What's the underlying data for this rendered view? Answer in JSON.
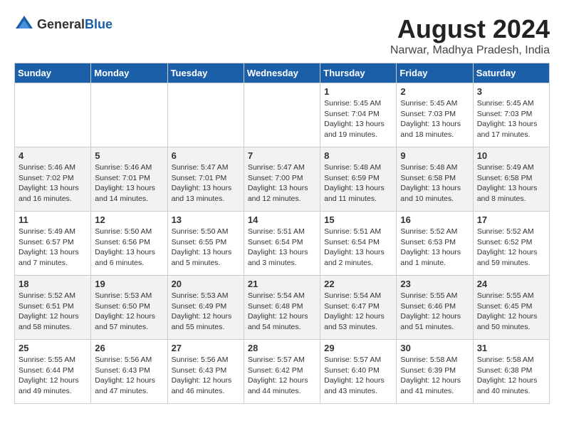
{
  "header": {
    "logo_general": "General",
    "logo_blue": "Blue",
    "month": "August 2024",
    "location": "Narwar, Madhya Pradesh, India"
  },
  "days_of_week": [
    "Sunday",
    "Monday",
    "Tuesday",
    "Wednesday",
    "Thursday",
    "Friday",
    "Saturday"
  ],
  "weeks": [
    [
      {
        "day": "",
        "info": ""
      },
      {
        "day": "",
        "info": ""
      },
      {
        "day": "",
        "info": ""
      },
      {
        "day": "",
        "info": ""
      },
      {
        "day": "1",
        "info": "Sunrise: 5:45 AM\nSunset: 7:04 PM\nDaylight: 13 hours\nand 19 minutes."
      },
      {
        "day": "2",
        "info": "Sunrise: 5:45 AM\nSunset: 7:03 PM\nDaylight: 13 hours\nand 18 minutes."
      },
      {
        "day": "3",
        "info": "Sunrise: 5:45 AM\nSunset: 7:03 PM\nDaylight: 13 hours\nand 17 minutes."
      }
    ],
    [
      {
        "day": "4",
        "info": "Sunrise: 5:46 AM\nSunset: 7:02 PM\nDaylight: 13 hours\nand 16 minutes."
      },
      {
        "day": "5",
        "info": "Sunrise: 5:46 AM\nSunset: 7:01 PM\nDaylight: 13 hours\nand 14 minutes."
      },
      {
        "day": "6",
        "info": "Sunrise: 5:47 AM\nSunset: 7:01 PM\nDaylight: 13 hours\nand 13 minutes."
      },
      {
        "day": "7",
        "info": "Sunrise: 5:47 AM\nSunset: 7:00 PM\nDaylight: 13 hours\nand 12 minutes."
      },
      {
        "day": "8",
        "info": "Sunrise: 5:48 AM\nSunset: 6:59 PM\nDaylight: 13 hours\nand 11 minutes."
      },
      {
        "day": "9",
        "info": "Sunrise: 5:48 AM\nSunset: 6:58 PM\nDaylight: 13 hours\nand 10 minutes."
      },
      {
        "day": "10",
        "info": "Sunrise: 5:49 AM\nSunset: 6:58 PM\nDaylight: 13 hours\nand 8 minutes."
      }
    ],
    [
      {
        "day": "11",
        "info": "Sunrise: 5:49 AM\nSunset: 6:57 PM\nDaylight: 13 hours\nand 7 minutes."
      },
      {
        "day": "12",
        "info": "Sunrise: 5:50 AM\nSunset: 6:56 PM\nDaylight: 13 hours\nand 6 minutes."
      },
      {
        "day": "13",
        "info": "Sunrise: 5:50 AM\nSunset: 6:55 PM\nDaylight: 13 hours\nand 5 minutes."
      },
      {
        "day": "14",
        "info": "Sunrise: 5:51 AM\nSunset: 6:54 PM\nDaylight: 13 hours\nand 3 minutes."
      },
      {
        "day": "15",
        "info": "Sunrise: 5:51 AM\nSunset: 6:54 PM\nDaylight: 13 hours\nand 2 minutes."
      },
      {
        "day": "16",
        "info": "Sunrise: 5:52 AM\nSunset: 6:53 PM\nDaylight: 13 hours\nand 1 minute."
      },
      {
        "day": "17",
        "info": "Sunrise: 5:52 AM\nSunset: 6:52 PM\nDaylight: 12 hours\nand 59 minutes."
      }
    ],
    [
      {
        "day": "18",
        "info": "Sunrise: 5:52 AM\nSunset: 6:51 PM\nDaylight: 12 hours\nand 58 minutes."
      },
      {
        "day": "19",
        "info": "Sunrise: 5:53 AM\nSunset: 6:50 PM\nDaylight: 12 hours\nand 57 minutes."
      },
      {
        "day": "20",
        "info": "Sunrise: 5:53 AM\nSunset: 6:49 PM\nDaylight: 12 hours\nand 55 minutes."
      },
      {
        "day": "21",
        "info": "Sunrise: 5:54 AM\nSunset: 6:48 PM\nDaylight: 12 hours\nand 54 minutes."
      },
      {
        "day": "22",
        "info": "Sunrise: 5:54 AM\nSunset: 6:47 PM\nDaylight: 12 hours\nand 53 minutes."
      },
      {
        "day": "23",
        "info": "Sunrise: 5:55 AM\nSunset: 6:46 PM\nDaylight: 12 hours\nand 51 minutes."
      },
      {
        "day": "24",
        "info": "Sunrise: 5:55 AM\nSunset: 6:45 PM\nDaylight: 12 hours\nand 50 minutes."
      }
    ],
    [
      {
        "day": "25",
        "info": "Sunrise: 5:55 AM\nSunset: 6:44 PM\nDaylight: 12 hours\nand 49 minutes."
      },
      {
        "day": "26",
        "info": "Sunrise: 5:56 AM\nSunset: 6:43 PM\nDaylight: 12 hours\nand 47 minutes."
      },
      {
        "day": "27",
        "info": "Sunrise: 5:56 AM\nSunset: 6:43 PM\nDaylight: 12 hours\nand 46 minutes."
      },
      {
        "day": "28",
        "info": "Sunrise: 5:57 AM\nSunset: 6:42 PM\nDaylight: 12 hours\nand 44 minutes."
      },
      {
        "day": "29",
        "info": "Sunrise: 5:57 AM\nSunset: 6:40 PM\nDaylight: 12 hours\nand 43 minutes."
      },
      {
        "day": "30",
        "info": "Sunrise: 5:58 AM\nSunset: 6:39 PM\nDaylight: 12 hours\nand 41 minutes."
      },
      {
        "day": "31",
        "info": "Sunrise: 5:58 AM\nSunset: 6:38 PM\nDaylight: 12 hours\nand 40 minutes."
      }
    ]
  ]
}
